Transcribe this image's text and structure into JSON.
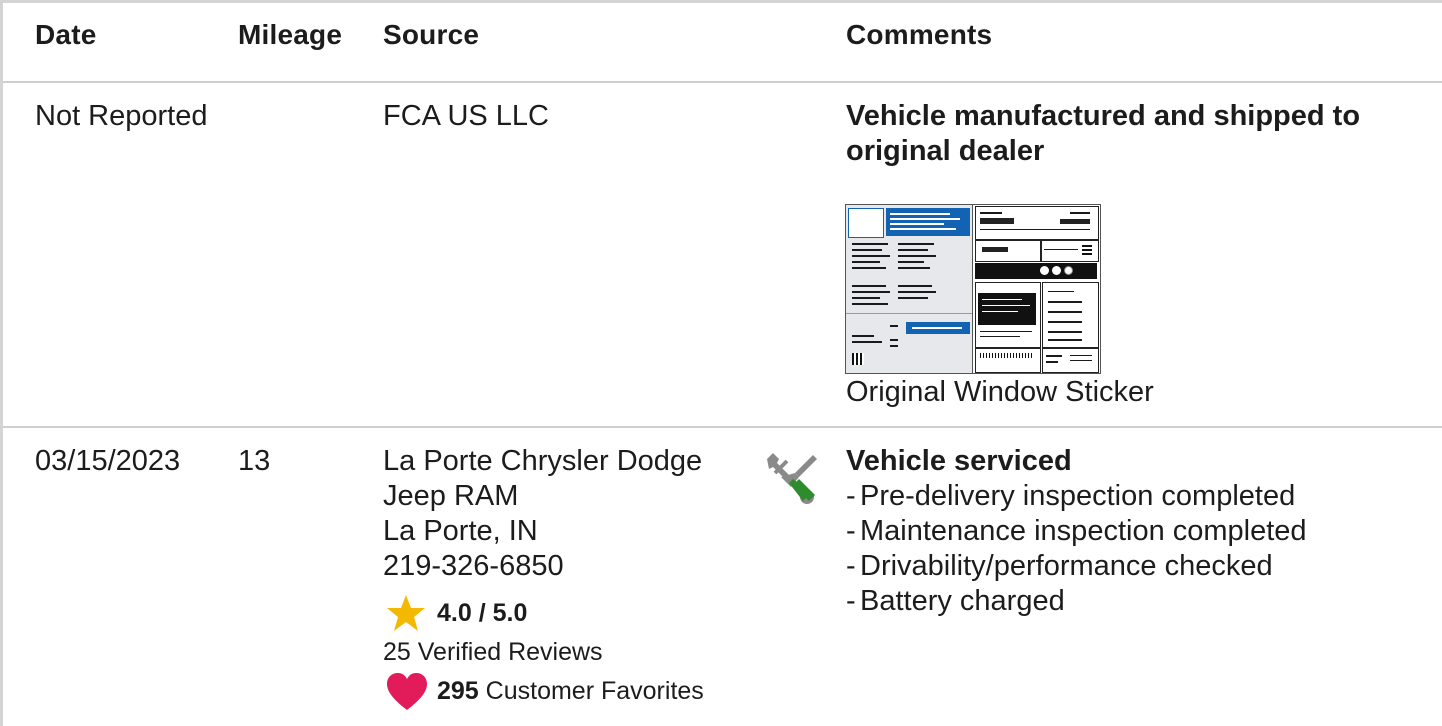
{
  "table": {
    "headers": {
      "date": "Date",
      "mileage": "Mileage",
      "source": "Source",
      "comments": "Comments"
    },
    "rows": [
      {
        "date": "Not Reported",
        "mileage": "",
        "source": [
          "FCA US LLC"
        ],
        "comment_title": "Vehicle manufactured and shipped to original dealer",
        "comment_title_lines": [
          "Vehicle manufactured and shipped to",
          "original dealer"
        ],
        "sticker_label": "Original Window Sticker"
      },
      {
        "date": "03/15/2023",
        "mileage": "13",
        "source": [
          "La Porte Chrysler Dodge",
          "Jeep RAM",
          "La Porte, IN",
          "219-326-6850"
        ],
        "rating": "4.0 / 5.0",
        "reviews": "25 Verified Reviews",
        "favorites_count": "295",
        "favorites_label": "Customer Favorites",
        "service_icon": "wrench-screwdriver-icon",
        "comment_title": "Vehicle serviced",
        "comment_items": [
          "Pre-delivery inspection completed",
          "Maintenance inspection completed",
          "Drivability/performance checked",
          "Battery charged"
        ]
      }
    ]
  },
  "icons": {
    "star": "star-icon",
    "heart": "heart-icon"
  },
  "colors": {
    "star": "#f5b800",
    "heart": "#e21b5a",
    "wrench": "#8a8a8a",
    "screwdriver": "#2e8b2e",
    "sticker_blue": "#1363b5"
  }
}
